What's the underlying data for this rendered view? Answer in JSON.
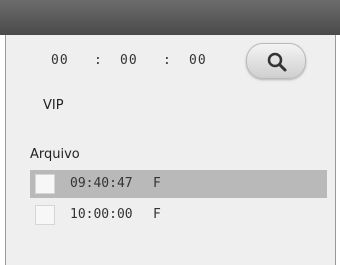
{
  "time_filter": {
    "hours": "00",
    "minutes": "00",
    "seconds": "00",
    "separator": ":"
  },
  "search_button": {
    "icon": "search-icon"
  },
  "vip_label": "VIP",
  "archive_label": "Arquivo",
  "files": [
    {
      "time": "09:40:47",
      "type": "F",
      "selected": true
    },
    {
      "time": "10:00:00",
      "type": "F",
      "selected": false
    }
  ]
}
